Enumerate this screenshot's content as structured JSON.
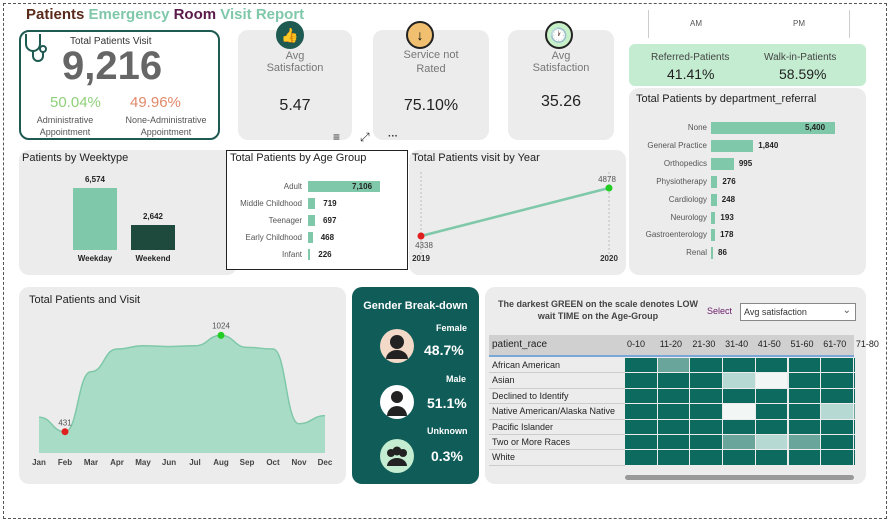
{
  "header": {
    "w1": "Patients",
    "w2": "Emergency",
    "w3": "Room",
    "w4": "Visit Report"
  },
  "total_card": {
    "label": "Total Patients Visit",
    "value": "9,216",
    "admin_pct": "50.04%",
    "admin_label": "Administrative Appointment",
    "nonadmin_pct": "49.96%",
    "nonadmin_label": "None-Administrative Appointment"
  },
  "kpis": [
    {
      "icon": "thumbs-up-icon",
      "label": "Avg Satisfaction",
      "value": "5.47"
    },
    {
      "icon": "arrow-down-icon",
      "label": "Service not Rated",
      "value": "75.10%"
    },
    {
      "icon": "clock-icon",
      "label": "Avg Satisfaction",
      "value": "35.26"
    }
  ],
  "visual_toolbar": {
    "filter": "≡",
    "expand": "⤢",
    "more": "···"
  },
  "top_right": {
    "am": "AM",
    "pm": "PM"
  },
  "referral": {
    "referred_label": "Referred-Patients",
    "referred_value": "41.41%",
    "walkin_label": "Walk-in-Patients",
    "walkin_value": "58.59%"
  },
  "colors": {
    "accent": "#7fc8a9",
    "dark": "#1e4a3e",
    "teal": "#0f5c58"
  },
  "chart_data": [
    {
      "type": "bar",
      "title": "Total Patients by department_referral",
      "categories": [
        "None",
        "General Practice",
        "Orthopedics",
        "Physiotherapy",
        "Cardiology",
        "Neurology",
        "Gastroenterology",
        "Renal"
      ],
      "values": [
        5400,
        1840,
        995,
        276,
        248,
        193,
        178,
        86
      ],
      "labels": [
        "5,400",
        "1,840",
        "995",
        "276",
        "248",
        "193",
        "178",
        "86"
      ]
    },
    {
      "type": "bar",
      "title": "Patients by Weektype",
      "categories": [
        "Weekday",
        "Weekend"
      ],
      "values": [
        6574,
        2642
      ],
      "labels": [
        "6,574",
        "2,642"
      ]
    },
    {
      "type": "bar",
      "title": "Total Patients by Age Group",
      "categories": [
        "Adult",
        "Middle Childhood",
        "Teenager",
        "Early Childhood",
        "Infant"
      ],
      "values": [
        7106,
        719,
        697,
        468,
        226
      ],
      "labels": [
        "7,106",
        "719",
        "697",
        "468",
        "226"
      ]
    },
    {
      "type": "line",
      "title": "Total Patients visit by Year",
      "x": [
        "2019",
        "2020"
      ],
      "values": [
        4338,
        4878
      ]
    },
    {
      "type": "area",
      "title": "Total Patients and Visit",
      "categories": [
        "Jan",
        "Feb",
        "Mar",
        "Apr",
        "May",
        "Jun",
        "Jul",
        "Aug",
        "Sep",
        "Oct",
        "Nov",
        "Dec"
      ],
      "values": [
        520,
        431,
        800,
        940,
        960,
        955,
        960,
        1024,
        950,
        940,
        480,
        530
      ],
      "min_label": "431",
      "max_label": "1024"
    },
    {
      "type": "heatmap",
      "title": "The darkest GREEN on the scale denotes LOW wait TIME on the Age-Group",
      "columns": [
        "0-10",
        "11-20",
        "21-30",
        "31-40",
        "41-50",
        "51-60",
        "61-70",
        "71-80"
      ],
      "rows": [
        "African American",
        "Asian",
        "Declined to Identify",
        "Native American/Alaska Native",
        "Pacific Islander",
        "Two or More Races",
        "White"
      ],
      "values": [
        [
          3,
          2,
          3,
          3,
          3,
          3,
          3,
          3
        ],
        [
          3,
          3,
          3,
          1,
          0,
          3,
          3,
          3
        ],
        [
          3,
          3,
          3,
          3,
          3,
          3,
          3,
          3
        ],
        [
          3,
          3,
          3,
          0,
          3,
          3,
          1,
          2
        ],
        [
          3,
          3,
          3,
          3,
          3,
          3,
          3,
          3
        ],
        [
          3,
          3,
          3,
          2,
          1,
          2,
          3,
          3
        ],
        [
          3,
          3,
          3,
          3,
          3,
          3,
          3,
          3
        ]
      ]
    }
  ],
  "gender": {
    "title": "Gender Break-down",
    "female_label": "Female",
    "female_value": "48.7%",
    "male_label": "Male",
    "male_value": "51.1%",
    "unknown_label": "Unknown",
    "unknown_value": "0.3%"
  },
  "heat_select": {
    "label": "Select",
    "value": "Avg satisfaction",
    "row_header": "patient_race"
  }
}
